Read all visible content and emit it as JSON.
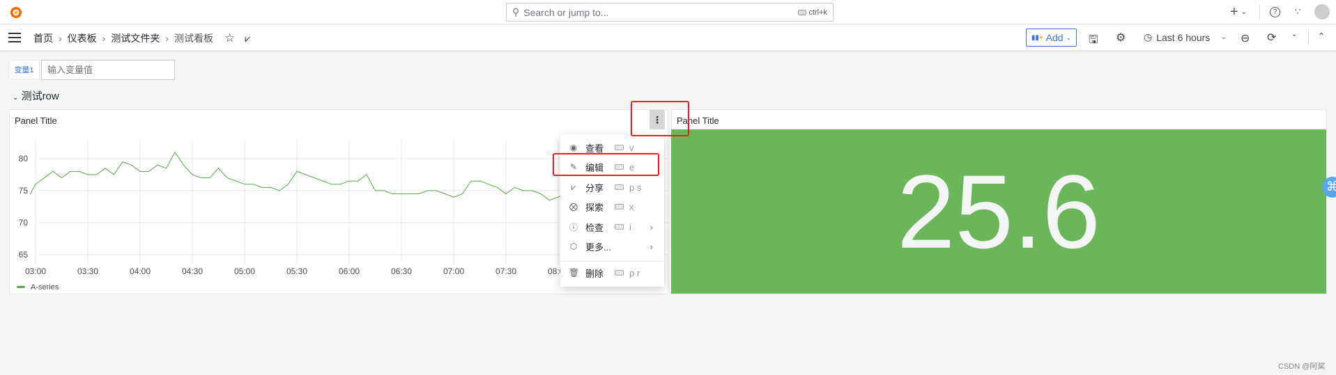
{
  "topbar": {
    "search_placeholder": "Search or jump to...",
    "search_shortcut": "ctrl+k",
    "icons": [
      "grafana-logo-icon",
      "plus-icon",
      "help-icon",
      "rss-icon",
      "avatar"
    ]
  },
  "nav": {
    "breadcrumbs": [
      "首页",
      "仪表板",
      "测试文件夹",
      "测试看板"
    ],
    "add_label": "Add",
    "time_range": "Last 6 hours"
  },
  "variables": {
    "label": "变量1",
    "placeholder": "输入变量值"
  },
  "row": {
    "title": "测试row"
  },
  "panels": [
    {
      "title": "Panel Title",
      "type": "timeseries"
    },
    {
      "title": "Panel Title",
      "type": "stat",
      "value": "25.6",
      "color": "#6bb55b"
    }
  ],
  "menu": {
    "items": [
      {
        "label": "查看",
        "shortcut": "v",
        "icon": "eye-icon"
      },
      {
        "label": "编辑",
        "shortcut": "e",
        "icon": "edit-icon"
      },
      {
        "label": "分享",
        "shortcut": "p s",
        "icon": "share-icon"
      },
      {
        "label": "探索",
        "shortcut": "x",
        "icon": "compass-icon"
      },
      {
        "label": "检查",
        "shortcut": "i",
        "icon": "info-icon",
        "submenu": true
      },
      {
        "label": "更多...",
        "shortcut": "",
        "icon": "cube-icon",
        "submenu": true
      },
      {
        "label": "删除",
        "shortcut": "p r",
        "icon": "trash-icon"
      }
    ]
  },
  "watermark": "CSDN @阿桨",
  "chart_data": {
    "type": "line",
    "title": "Panel Title",
    "xlabel": "",
    "ylabel": "",
    "ylim": [
      63.5,
      83
    ],
    "yticks": [
      65,
      70,
      75,
      80
    ],
    "xticks": [
      "03:00",
      "03:30",
      "04:00",
      "04:30",
      "05:00",
      "05:30",
      "06:00",
      "06:30",
      "07:00",
      "07:30",
      "08:00"
    ],
    "grid": true,
    "legend_placement": "bottom-left",
    "series": [
      {
        "name": "A-series",
        "color": "#56a64b",
        "x": [
          "02:57",
          "03:00",
          "03:05",
          "03:10",
          "03:15",
          "03:20",
          "03:25",
          "03:30",
          "03:35",
          "03:40",
          "03:45",
          "03:50",
          "03:55",
          "04:00",
          "04:05",
          "04:10",
          "04:15",
          "04:20",
          "04:25",
          "04:30",
          "04:35",
          "04:40",
          "04:45",
          "04:50",
          "04:55",
          "05:00",
          "05:05",
          "05:10",
          "05:15",
          "05:20",
          "05:25",
          "05:30",
          "05:35",
          "05:40",
          "05:45",
          "05:50",
          "05:55",
          "06:00",
          "06:05",
          "06:10",
          "06:15",
          "06:20",
          "06:25",
          "06:30",
          "06:35",
          "06:40",
          "06:45",
          "06:50",
          "06:55",
          "07:00",
          "07:05",
          "07:10",
          "07:15",
          "07:20",
          "07:25",
          "07:30",
          "07:35",
          "07:40",
          "07:45",
          "07:50",
          "07:55",
          "08:00",
          "08:05"
        ],
        "y": [
          74.5,
          76,
          77,
          78,
          77,
          78,
          78,
          77.5,
          77.5,
          78.5,
          77.5,
          79.5,
          79,
          78,
          78,
          79,
          78.5,
          81,
          79,
          77.5,
          77,
          77,
          78.5,
          77,
          76.5,
          76,
          76,
          75.5,
          75.5,
          75,
          76,
          78,
          77.5,
          77,
          76.5,
          76,
          76,
          76.5,
          76.5,
          77.5,
          75,
          75,
          74.5,
          74.5,
          74.5,
          74.5,
          75,
          75,
          74.5,
          74,
          74.5,
          76.5,
          76.5,
          76,
          75.5,
          74.5,
          75.5,
          75,
          75,
          74.5,
          73.5,
          74,
          74.5
        ]
      }
    ]
  }
}
